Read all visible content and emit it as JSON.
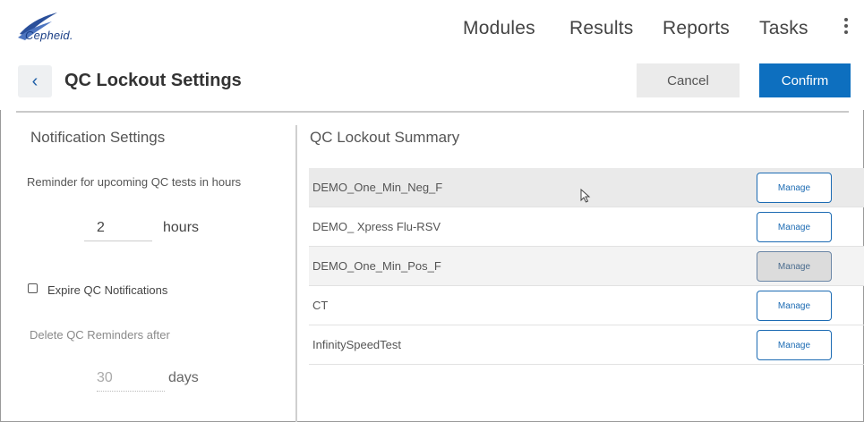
{
  "brand": {
    "name": "Cepheid."
  },
  "nav": {
    "modules": "Modules",
    "results": "Results",
    "reports": "Reports",
    "tasks": "Tasks"
  },
  "header": {
    "title": "QC Lockout Settings",
    "cancel_label": "Cancel",
    "confirm_label": "Confirm"
  },
  "notification_settings": {
    "heading": "Notification Settings",
    "reminder_label": "Reminder for upcoming QC tests in hours",
    "hours_value": "2",
    "hours_unit": "hours",
    "expire_label": "Expire QC Notifications",
    "expire_checked": false,
    "delete_label": "Delete QC Reminders after",
    "days_value": "30",
    "days_unit": "days"
  },
  "summary": {
    "heading": "QC Lockout Summary",
    "manage_label": "Manage",
    "items": [
      {
        "name": "DEMO_One_Min_Neg_F"
      },
      {
        "name": "DEMO_ Xpress Flu-RSV"
      },
      {
        "name": "DEMO_One_Min_Pos_F"
      },
      {
        "name": "CT"
      },
      {
        "name": "InfinitySpeedTest"
      }
    ]
  },
  "colors": {
    "accent": "#0d6fbf",
    "brand": "#1b3f86"
  }
}
